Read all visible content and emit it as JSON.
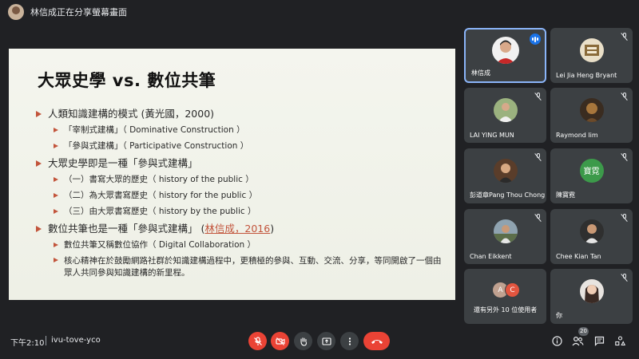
{
  "banner": {
    "text": "林信成正在分享螢幕畫面"
  },
  "slide": {
    "title": "大眾史學 vs. 數位共筆",
    "bullets": [
      {
        "level": 1,
        "text": "人類知識建構的模式 (黃光國，2000)"
      },
      {
        "level": 2,
        "text": "「宰制式建構」（ Dominative Construction ）"
      },
      {
        "level": 2,
        "text": "「參與式建構」（ Participative Construction ）"
      },
      {
        "level": 1,
        "text": "大眾史學即是一種「參與式建構」"
      },
      {
        "level": 2,
        "text": "（一）書寫大眾的歷史（ history of the public ）"
      },
      {
        "level": 2,
        "text": "（二）為大眾書寫歷史（ history for the public ）"
      },
      {
        "level": 2,
        "text": "（三）由大眾書寫歷史（ history by the public ）"
      },
      {
        "level": 1,
        "text": "數位共筆也是一種「參與式建構」",
        "paren_open": "(",
        "link": "林信成，2016",
        "paren_close": ")"
      },
      {
        "level": 2,
        "text": "數位共筆又稱數位協作（ Digital Collaboration ）"
      },
      {
        "level": 2,
        "text": "核心精神在於鼓勵網路社群於知識建構過程中，更積極的參與、互動、交流、分享，等同開啟了一個由眾人共同參與知識建構的新里程。"
      }
    ],
    "accent_color": "#c2543b"
  },
  "participants": [
    {
      "name": "林信成",
      "state": "speaking"
    },
    {
      "name": "Lei Jia Heng Bryant",
      "state": "muted"
    },
    {
      "name": "LAI YING MUN",
      "state": "muted"
    },
    {
      "name": "Raymond lim",
      "state": "muted"
    },
    {
      "name": "彭道章Pang Thou Chong",
      "state": "muted"
    },
    {
      "name": "陳寶霓",
      "initials": "寶霓",
      "avatar_color": "#3c9a4a",
      "state": "muted"
    },
    {
      "name": "Chan Eikkent",
      "state": "muted"
    },
    {
      "name": "Chee Kian Tan",
      "state": "muted"
    },
    {
      "name": "還有另外 10 位使用者",
      "others": [
        "A",
        "C"
      ],
      "others_colors": [
        "#c0a190",
        "#e2553f"
      ]
    },
    {
      "name": "你",
      "state": "muted"
    }
  ],
  "bottom_bar": {
    "time": "下午2:10",
    "meeting_code": "ivu-tove-yco",
    "participant_count": "20"
  },
  "icons": {
    "mic": "mic-off-icon",
    "camera": "camera-off-icon",
    "hand": "raise-hand-icon",
    "present": "present-icon",
    "more": "more-vert-icon",
    "hangup": "call-end-icon",
    "info": "info-icon",
    "people": "people-icon",
    "chat": "chat-icon",
    "activities": "activities-icon"
  }
}
